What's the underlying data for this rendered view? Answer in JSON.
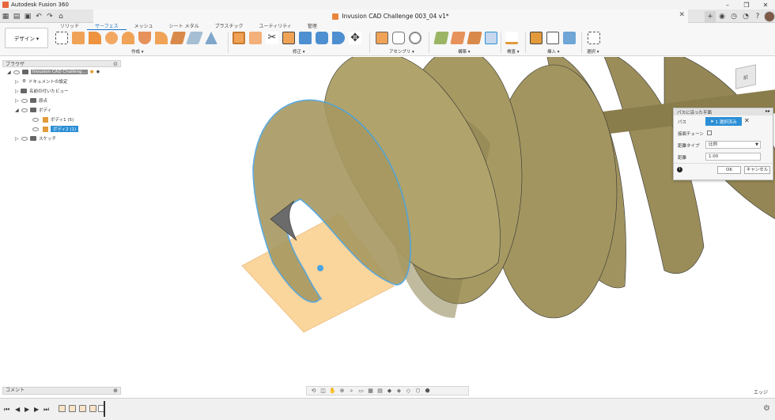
{
  "window": {
    "app_title": "Autodesk Fusion 360",
    "minimize": "–",
    "maximize": "❐",
    "close": "✕"
  },
  "doc_tab": {
    "title": "Invusion CAD Challenge 003_04 v1*",
    "close": "✕"
  },
  "workspace": {
    "label": "デザイン ▾"
  },
  "ribbon_tabs": [
    {
      "label": "ソリッド",
      "active": false
    },
    {
      "label": "サーフェス",
      "active": true
    },
    {
      "label": "メッシュ",
      "active": false
    },
    {
      "label": "シート メタル",
      "active": false
    },
    {
      "label": "プラスチック",
      "active": false
    },
    {
      "label": "ユーティリティ",
      "active": false
    },
    {
      "label": "管理",
      "active": false
    }
  ],
  "tool_groups": [
    {
      "label": "作成 ▾"
    },
    {
      "label": "修正 ▾"
    },
    {
      "label": "アセンブリ ▾"
    },
    {
      "label": "構築 ▾"
    },
    {
      "label": "検査 ▾"
    },
    {
      "label": "挿入 ▾"
    },
    {
      "label": "選択 ▾"
    }
  ],
  "browser": {
    "title": "ブラウザ",
    "root": "Invusion CAD Challeng...",
    "items": [
      {
        "label": "ドキュメントの設定"
      },
      {
        "label": "名前の付いたビュー"
      },
      {
        "label": "原点"
      },
      {
        "label": "ボディ"
      },
      {
        "label": "ボディ1 (5)"
      },
      {
        "label": "ボディ2 (1)"
      },
      {
        "label": "スケッチ"
      }
    ]
  },
  "dialog": {
    "title": "パスに沿った平面",
    "path_label": "パス",
    "path_value": "1 選択済み",
    "chain_label": "接面チェーン",
    "distance_type_label": "距離タイプ",
    "distance_type_value": "比例",
    "distance_label": "距離",
    "distance_value": "1.00",
    "ok": "OK",
    "cancel": "キャンセル"
  },
  "viewcube": {
    "face_label": "前"
  },
  "comments": {
    "label": "コメント"
  },
  "status": {
    "edge_label": "エッジ"
  },
  "colors": {
    "surface": "#9c8f5a",
    "surface_dark": "#7a6d40",
    "plane": "#f9c87c",
    "highlight": "#4aa3e0",
    "accent": "#2b8fd6"
  }
}
